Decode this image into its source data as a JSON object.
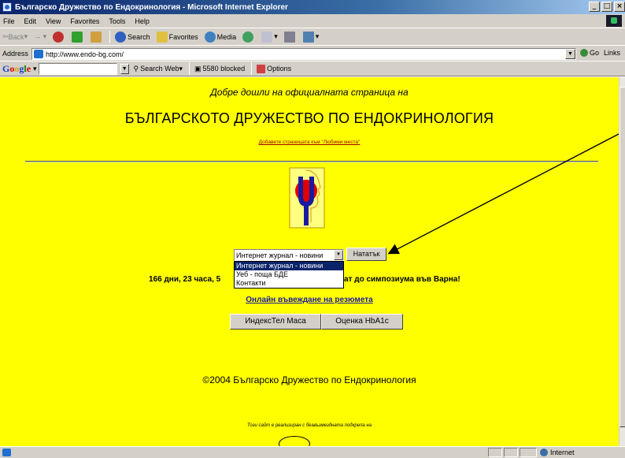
{
  "window": {
    "title": "Българско Дружество по Ендокринология - Microsoft Internet Explorer",
    "controls": [
      "_",
      "□",
      "×"
    ]
  },
  "menu": {
    "items": [
      "File",
      "Edit",
      "View",
      "Favorites",
      "Tools",
      "Help"
    ]
  },
  "toolbar": {
    "back": "Back",
    "search": "Search",
    "favorites": "Favorites",
    "media": "Media"
  },
  "address": {
    "label": "Address",
    "url": "http://www.endo-bg.com/",
    "go": "Go",
    "links": "Links"
  },
  "google_bar": {
    "logo": "Google",
    "search_web": "Search Web",
    "blocked": "5580 blocked",
    "options": "Options"
  },
  "page": {
    "welcome": "Добре дошли на официалната страница на",
    "society_name": "БЪЛГАРСКОТО ДРУЖЕСТВО ПО ЕНДОКРИНОЛОГИЯ",
    "add_favorites": "Добавете страницата към \"Любими места\"",
    "select": {
      "selected": "Интернет журнал - новини",
      "options": [
        "Интернет журнал - новини",
        "Уеб - поща БДЕ",
        "Контакти"
      ]
    },
    "go_button": "Нататък",
    "countdown_left": "166 дни, 23 часа, 5",
    "countdown_right": "ат до симпозиума във Варна!",
    "abstract_link": "Онлайн въвеждане на резюмета",
    "bmi_button": "ИндексТел Маса",
    "hba1c_button": "Оценка HbA1c",
    "copyright": "©2004 Българско Дружество по Ендокринология",
    "sponsor_note": "Този сайт е реализиран с безвъзмездната подкрепа на"
  },
  "status": {
    "zone": "Internet"
  },
  "colors": {
    "page_background": "#ffff00",
    "titlebar": "#0a246a",
    "chrome": "#d4d0c8",
    "link": "#1a1aa0",
    "highlight": "#0a246a"
  },
  "icons": {
    "app": "internet-explorer-icon",
    "logo": "society-emblem",
    "annotation": "arrow-annotation"
  }
}
